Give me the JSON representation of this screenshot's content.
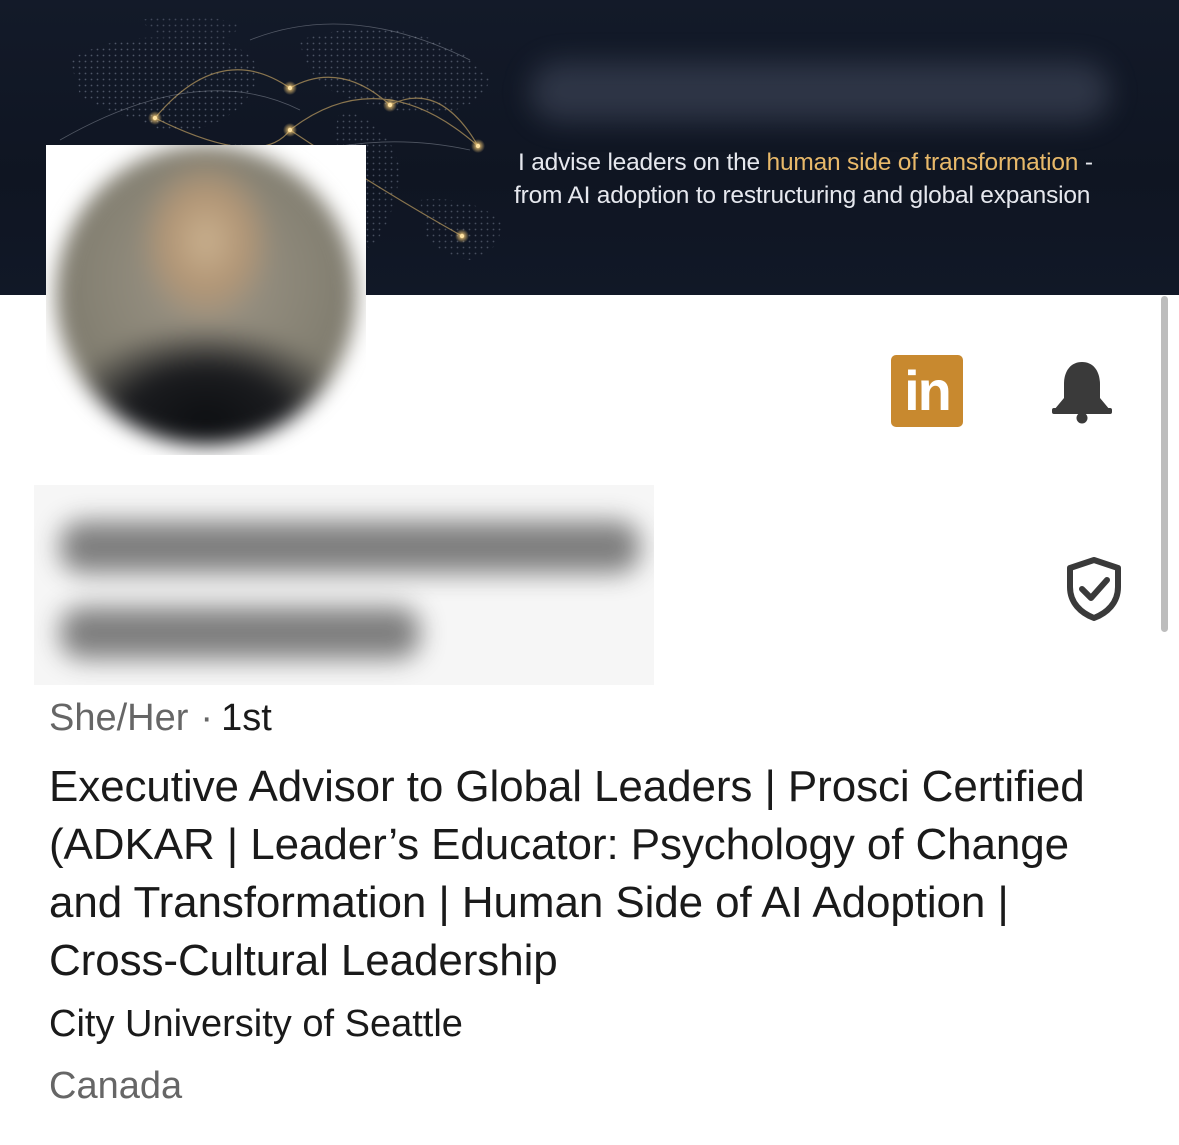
{
  "banner": {
    "tagline_part1": "I advise leaders on the ",
    "tagline_highlight": "human side of transformation",
    "tagline_part2": " -",
    "tagline_line2": "from AI adoption to restructuring and global expansion",
    "highlight_color": "#e8b96a"
  },
  "badges": {
    "linkedin_label": "in",
    "linkedin_color": "#c8892f",
    "bell_icon": "bell-icon",
    "verified_icon": "shield-check-icon"
  },
  "profile": {
    "pronouns": "She/Her",
    "separator": "·",
    "connection_degree": "1st",
    "headline": "Executive Advisor to Global Leaders | Prosci Certified (ADKAR | Leader’s Educator: Psychology of Change and Transformation | Human Side of AI Adoption | Cross-Cultural Leadership",
    "school": "City University of Seattle",
    "location": "Canada"
  }
}
